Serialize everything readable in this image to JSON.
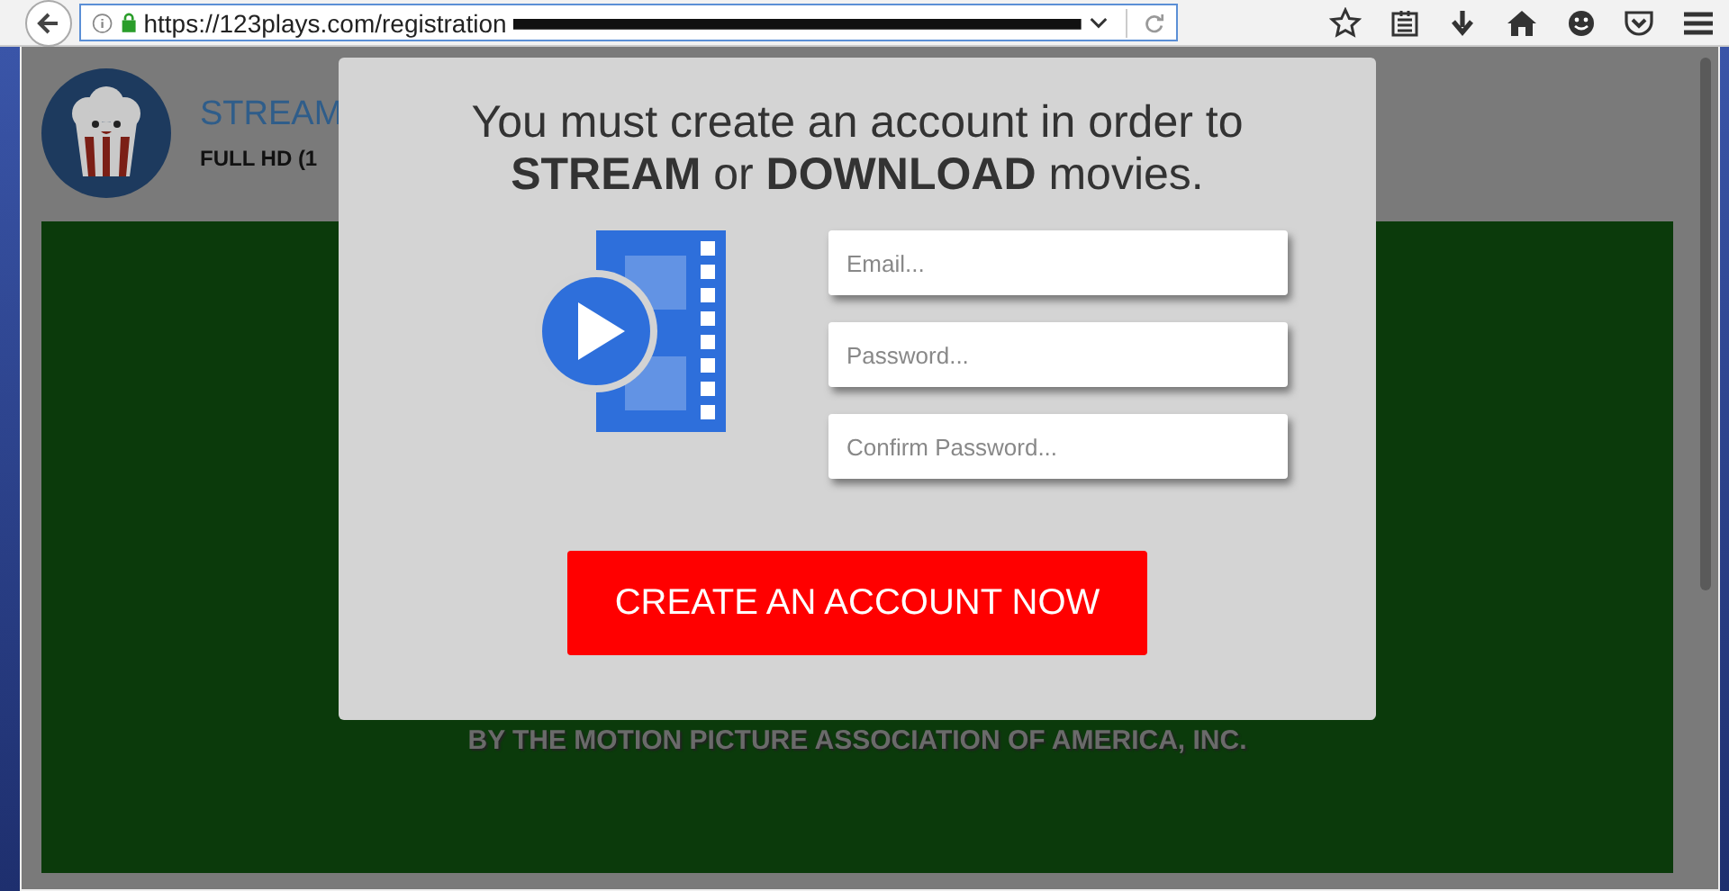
{
  "browser": {
    "url": "https://123plays.com/registration"
  },
  "site": {
    "title": "STREAM",
    "subtitle": "FULL HD (1",
    "notice": "BY THE MOTION PICTURE ASSOCIATION OF AMERICA, INC."
  },
  "modal": {
    "heading": "You must create an account in order to",
    "subheading": "**STREAM** or **DOWNLOAD** movies.",
    "fields": [
      {
        "placeholder": "Email..."
      },
      {
        "placeholder": "Password..."
      },
      {
        "placeholder": "Confirm Password..."
      }
    ],
    "button": "CREATE AN ACCOUNT NOW"
  }
}
